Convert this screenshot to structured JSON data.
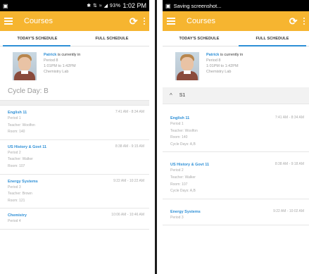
{
  "left": {
    "status": {
      "icons": "✱ ⇅ ≈ ◢ 93%",
      "time": "1:02 PM"
    },
    "app_title": "Courses",
    "tabs": [
      "TODAY'S SCHEDULE",
      "FULL SCHEDULE"
    ],
    "profile": {
      "name": "Patrick",
      "status": "is currently in",
      "period": "Period 8",
      "time": "1:01PM to 1:42PM",
      "location": "Chemistry Lab"
    },
    "cycle_day": "Cycle Day: B",
    "courses": [
      {
        "name": "English 11",
        "time": "7:41 AM - 8:34 AM",
        "period": "Period 1",
        "teacher": "Teacher: Woolfon",
        "room": "Room: 140"
      },
      {
        "name": "US History & Govt 11",
        "time": "8:38 AM - 9:15 AM",
        "period": "Period 2",
        "teacher": "Teacher: Walker",
        "room": "Room: 107"
      },
      {
        "name": "Energy Systems",
        "time": "9:22 AM - 10:22 AM",
        "period": "Period 3",
        "teacher": "Teacher: Brown",
        "room": "Room: 121"
      },
      {
        "name": "Chemistry",
        "time": "10:06 AM - 10:46 AM",
        "period": "Period 4"
      }
    ]
  },
  "right": {
    "status": {
      "message": "Saving screenshot..."
    },
    "app_title": "Courses",
    "tabs": [
      "TODAY'S SCHEDULE",
      "FULL SCHEDULE"
    ],
    "profile": {
      "name": "Patrick",
      "status": "is currently in",
      "period": "Period 8",
      "time": "1:01PM to 1:42PM",
      "location": "Chemistry Lab"
    },
    "section": {
      "chevron": "^",
      "label": "S1"
    },
    "courses": [
      {
        "name": "English 11",
        "time": "7:41 AM - 8:34 AM",
        "period": "Period 1",
        "teacher": "Teacher: Woolfon",
        "room": "Room: 140",
        "cycle": "Cycle Days: A,B"
      },
      {
        "name": "US History & Govt 11",
        "time": "8:38 AM - 9:18 AM",
        "period": "Period 2",
        "teacher": "Teacher: Walker",
        "room": "Room: 107",
        "cycle": "Cycle Days: A,B"
      },
      {
        "name": "Energy Systems",
        "time": "9:22 AM - 10:02 AM",
        "period": "Period 3"
      }
    ]
  },
  "colors": {
    "appbar": "#f6b530",
    "accent": "#2d8fd6",
    "statusbar": "#000000"
  },
  "icons": [
    "menu-icon",
    "refresh-icon",
    "more-vert-icon",
    "chevron-up-icon",
    "screenshot-icon"
  ]
}
